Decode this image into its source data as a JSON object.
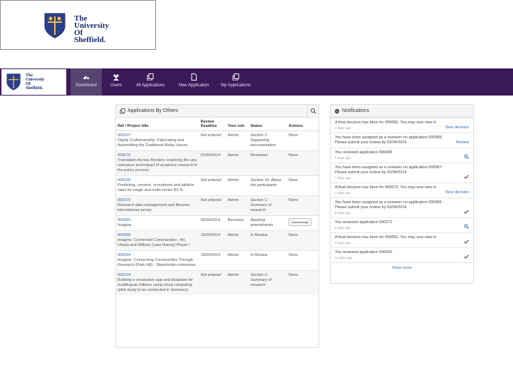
{
  "brand": {
    "line1": "The",
    "line2": "University",
    "line3": "Of",
    "line4": "Sheffield."
  },
  "nav": {
    "items": [
      {
        "label": "Dashboard",
        "icon": "dashboard-icon",
        "active": true
      },
      {
        "label": "Users",
        "icon": "users-icon",
        "active": false
      },
      {
        "label": "All Applications",
        "icon": "applications-icon",
        "active": false
      },
      {
        "label": "New Application",
        "icon": "new-application-icon",
        "active": false
      },
      {
        "label": "My Applications",
        "icon": "my-applications-icon",
        "active": false
      }
    ]
  },
  "applications": {
    "title": "Applications By Others",
    "headers": {
      "ref": "Ref / Project title",
      "deadline": "Review Deadline",
      "role": "Your role",
      "status": "Status",
      "actions": "Actions"
    },
    "rows": [
      {
        "ref": "000107",
        "title": "Digital Craftsmanship: Fabricating and Assembling the Traditional Malay House",
        "deadline": "Not entered",
        "role": "Admin",
        "status": "Section 1: Supporting documentation",
        "action": "None"
      },
      {
        "ref": "000076",
        "title": "Translation Across Borders: exploring the use, relevance and impact of academic research in the policy process",
        "deadline": "01/04/2014",
        "role": "Admin",
        "status": "Reviewed",
        "action": "None"
      },
      {
        "ref": "000100",
        "title": "Predicting, consent, recruitment and attrition rates for single and multi-centre RCTs",
        "deadline": "Not entered",
        "role": "Admin",
        "status": "Section 1b: About the participants",
        "action": "None"
      },
      {
        "ref": "000079",
        "title": "Research data management and libraries: international survey",
        "deadline": "Not entered",
        "role": "Admin",
        "status": "Section C: Summary of research",
        "action": "None"
      },
      {
        "ref": "000065",
        "title": "Imagine",
        "deadline": "05/04/2014",
        "role": "Reviewer",
        "status": "Awaiting amendments",
        "action": "Acknowledge"
      },
      {
        "ref": "000056",
        "title": "Imagine: Connected Communities - Art, Utopia and Hillbury (case history) Phase I",
        "deadline": "16/04/2014",
        "role": "Admin",
        "status": "In Review",
        "action": "None"
      },
      {
        "ref": "000094",
        "title": "Imagine: Connecting Communities Through Research (Park Hill) - Stakeholder interviews",
        "deadline": "16/04/2014",
        "role": "Admin",
        "status": "In Review",
        "action": "None"
      },
      {
        "ref": "000104",
        "title": "Building a vocabulary app and database for multilingual children using cloud computing (pilot study to be conducted in Germany)",
        "deadline": "Not entered",
        "role": "Admin",
        "status": "Section C: Summary of research",
        "action": "None"
      }
    ]
  },
  "notifications": {
    "title": "Notifications",
    "items": [
      {
        "text": "A final decision has been for 000080. You may now view it.",
        "ago": "2 days ago",
        "action": "View decision",
        "icon": ""
      },
      {
        "text": "You have been assigned as a reviewer on application 000088. Please submit your review by 03/04/2014",
        "ago": "",
        "action": "Review",
        "icon": ""
      },
      {
        "text": "You reviewed application 000089",
        "ago": "5 days ago",
        "action": "",
        "icon": "search-icon"
      },
      {
        "text": "You have been assigned as a reviewer on application 000087. Please submit your review by 03/04/2014",
        "ago": "7 days ago",
        "action": "",
        "icon": "check-icon"
      },
      {
        "text": "A final decision has been for 000072. You may now view it.",
        "ago": "1 days ago",
        "action": "View decision",
        "icon": ""
      },
      {
        "text": "You have been assigned as a reviewer on application 000065. Please submit your review by 03/04/2014",
        "ago": "8 days ago",
        "action": "",
        "icon": "check-icon"
      },
      {
        "text": "You reviewed application 000072",
        "ago": "8 days ago",
        "action": "",
        "icon": "search-icon"
      },
      {
        "text": "A final decision has been for 000052. You may now view it.",
        "ago": "8 days ago",
        "action": "",
        "icon": "check-icon"
      },
      {
        "text": "You reviewed application 000042",
        "ago": "11 days ago",
        "action": "",
        "icon": "check-icon"
      }
    ],
    "show_more": "Show more"
  },
  "colors": {
    "navbar": "#3b1a5a",
    "nav_active": "#564471",
    "link": "#2a6ab0"
  }
}
